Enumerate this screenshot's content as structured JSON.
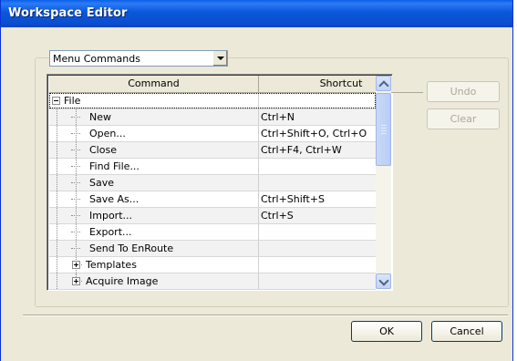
{
  "window": {
    "title": "Workspace Editor"
  },
  "category_select": {
    "value": "Menu Commands"
  },
  "table": {
    "headers": {
      "command": "Command",
      "shortcut": "Shortcut"
    },
    "rows": [
      {
        "command": "File",
        "shortcut": "",
        "level": 0,
        "expander": "minus"
      },
      {
        "command": "New",
        "shortcut": "Ctrl+N",
        "level": 1
      },
      {
        "command": "Open...",
        "shortcut": "Ctrl+Shift+O, Ctrl+O",
        "level": 1
      },
      {
        "command": "Close",
        "shortcut": "Ctrl+F4, Ctrl+W",
        "level": 1
      },
      {
        "command": "Find File...",
        "shortcut": "",
        "level": 1
      },
      {
        "command": "Save",
        "shortcut": "",
        "level": 1
      },
      {
        "command": "Save As...",
        "shortcut": "Ctrl+Shift+S",
        "level": 1
      },
      {
        "command": "Import...",
        "shortcut": "Ctrl+S",
        "level": 1
      },
      {
        "command": "Export...",
        "shortcut": "",
        "level": 1
      },
      {
        "command": "Send To EnRoute",
        "shortcut": "",
        "level": 1
      },
      {
        "command": "Templates",
        "shortcut": "",
        "level": 1,
        "expander": "plus"
      },
      {
        "command": "Acquire Image",
        "shortcut": "",
        "level": 1,
        "expander": "plus"
      }
    ]
  },
  "buttons": {
    "undo": "Undo",
    "clear": "Clear",
    "ok": "OK",
    "cancel": "Cancel"
  },
  "icons": {
    "combo_arrow": "chevron-down-icon",
    "scroll_up": "chevron-up-icon",
    "scroll_down": "chevron-down-icon",
    "collapse": "minus-box-icon",
    "expand": "plus-box-icon"
  }
}
